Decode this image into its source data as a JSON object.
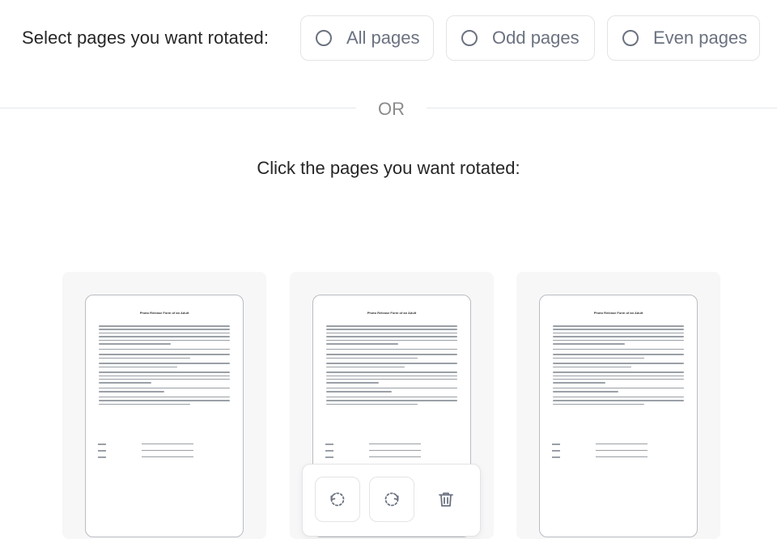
{
  "select_pages": {
    "label": "Select pages you want rotated:",
    "options": [
      {
        "label": "All pages",
        "selected": false
      },
      {
        "label": "Odd pages",
        "selected": false
      },
      {
        "label": "Even pages",
        "selected": false
      }
    ]
  },
  "divider": {
    "label": "OR"
  },
  "click_pages": {
    "label": "Click the pages you want rotated:"
  },
  "pages": [
    {
      "thumbnail_title": "Photo Release Form of an Adult"
    },
    {
      "thumbnail_title": "Photo Release Form of an Adult"
    },
    {
      "thumbnail_title": "Photo Release Form of an Adult"
    }
  ],
  "page_toolbar": {
    "buttons": [
      {
        "icon": "rotate-counterclockwise-icon"
      },
      {
        "icon": "rotate-clockwise-icon"
      },
      {
        "icon": "trash-icon"
      }
    ]
  },
  "colors": {
    "border": "#e4e4e7",
    "muted_text": "#6b7280",
    "card_bg": "#f7f7f8"
  }
}
